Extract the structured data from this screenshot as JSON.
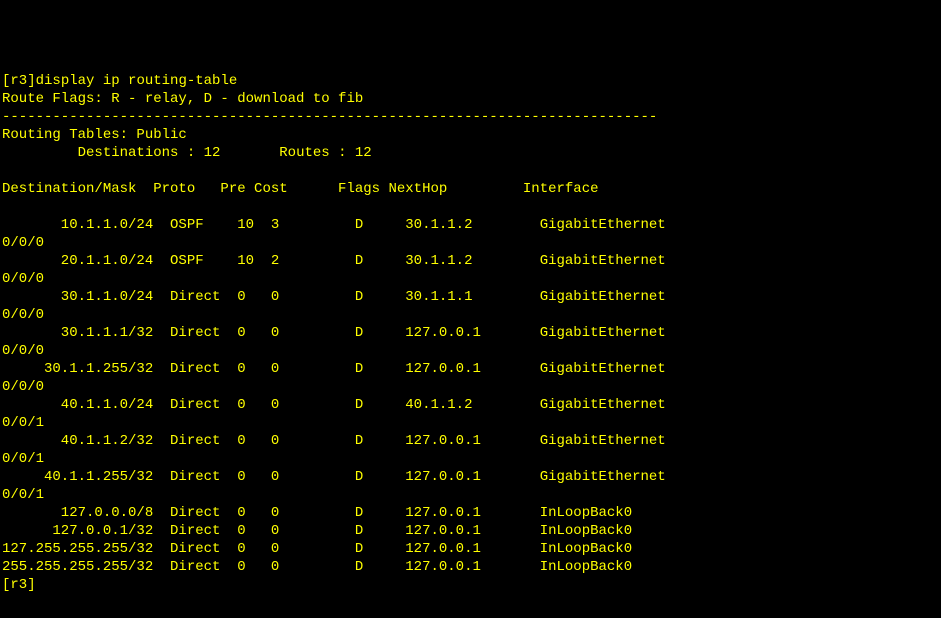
{
  "prompt_host": "r3",
  "command": "display ip routing-table",
  "flags_legend": "Route Flags: R - relay, D - download to fib",
  "divider": "------------------------------------------------------------------------------",
  "tables_title": "Routing Tables: Public",
  "summary": {
    "destinations_label": "Destinations :",
    "destinations_value": "12",
    "routes_label": "Routes :",
    "routes_value": "12"
  },
  "columns": {
    "dest": "Destination/Mask",
    "proto": "Proto",
    "pre": "Pre",
    "cost": "Cost",
    "flags": "Flags",
    "nexthop": "NextHop",
    "interface": "Interface"
  },
  "routes": [
    {
      "dest": "10.1.1.0/24",
      "proto": "OSPF",
      "pre": "10",
      "cost": "3",
      "flags": "D",
      "nexthop": "30.1.1.2",
      "iface": "GigabitEthernet",
      "iface2": "0/0/0"
    },
    {
      "dest": "20.1.1.0/24",
      "proto": "OSPF",
      "pre": "10",
      "cost": "2",
      "flags": "D",
      "nexthop": "30.1.1.2",
      "iface": "GigabitEthernet",
      "iface2": "0/0/0"
    },
    {
      "dest": "30.1.1.0/24",
      "proto": "Direct",
      "pre": "0",
      "cost": "0",
      "flags": "D",
      "nexthop": "30.1.1.1",
      "iface": "GigabitEthernet",
      "iface2": "0/0/0"
    },
    {
      "dest": "30.1.1.1/32",
      "proto": "Direct",
      "pre": "0",
      "cost": "0",
      "flags": "D",
      "nexthop": "127.0.0.1",
      "iface": "GigabitEthernet",
      "iface2": "0/0/0"
    },
    {
      "dest": "30.1.1.255/32",
      "proto": "Direct",
      "pre": "0",
      "cost": "0",
      "flags": "D",
      "nexthop": "127.0.0.1",
      "iface": "GigabitEthernet",
      "iface2": "0/0/0"
    },
    {
      "dest": "40.1.1.0/24",
      "proto": "Direct",
      "pre": "0",
      "cost": "0",
      "flags": "D",
      "nexthop": "40.1.1.2",
      "iface": "GigabitEthernet",
      "iface2": "0/0/1"
    },
    {
      "dest": "40.1.1.2/32",
      "proto": "Direct",
      "pre": "0",
      "cost": "0",
      "flags": "D",
      "nexthop": "127.0.0.1",
      "iface": "GigabitEthernet",
      "iface2": "0/0/1"
    },
    {
      "dest": "40.1.1.255/32",
      "proto": "Direct",
      "pre": "0",
      "cost": "0",
      "flags": "D",
      "nexthop": "127.0.0.1",
      "iface": "GigabitEthernet",
      "iface2": "0/0/1"
    },
    {
      "dest": "127.0.0.0/8",
      "proto": "Direct",
      "pre": "0",
      "cost": "0",
      "flags": "D",
      "nexthop": "127.0.0.1",
      "iface": "InLoopBack0",
      "iface2": ""
    },
    {
      "dest": "127.0.0.1/32",
      "proto": "Direct",
      "pre": "0",
      "cost": "0",
      "flags": "D",
      "nexthop": "127.0.0.1",
      "iface": "InLoopBack0",
      "iface2": ""
    },
    {
      "dest": "127.255.255.255/32",
      "proto": "Direct",
      "pre": "0",
      "cost": "0",
      "flags": "D",
      "nexthop": "127.0.0.1",
      "iface": "InLoopBack0",
      "iface2": ""
    },
    {
      "dest": "255.255.255.255/32",
      "proto": "Direct",
      "pre": "0",
      "cost": "0",
      "flags": "D",
      "nexthop": "127.0.0.1",
      "iface": "InLoopBack0",
      "iface2": ""
    }
  ],
  "end_prompt": "[r3]"
}
